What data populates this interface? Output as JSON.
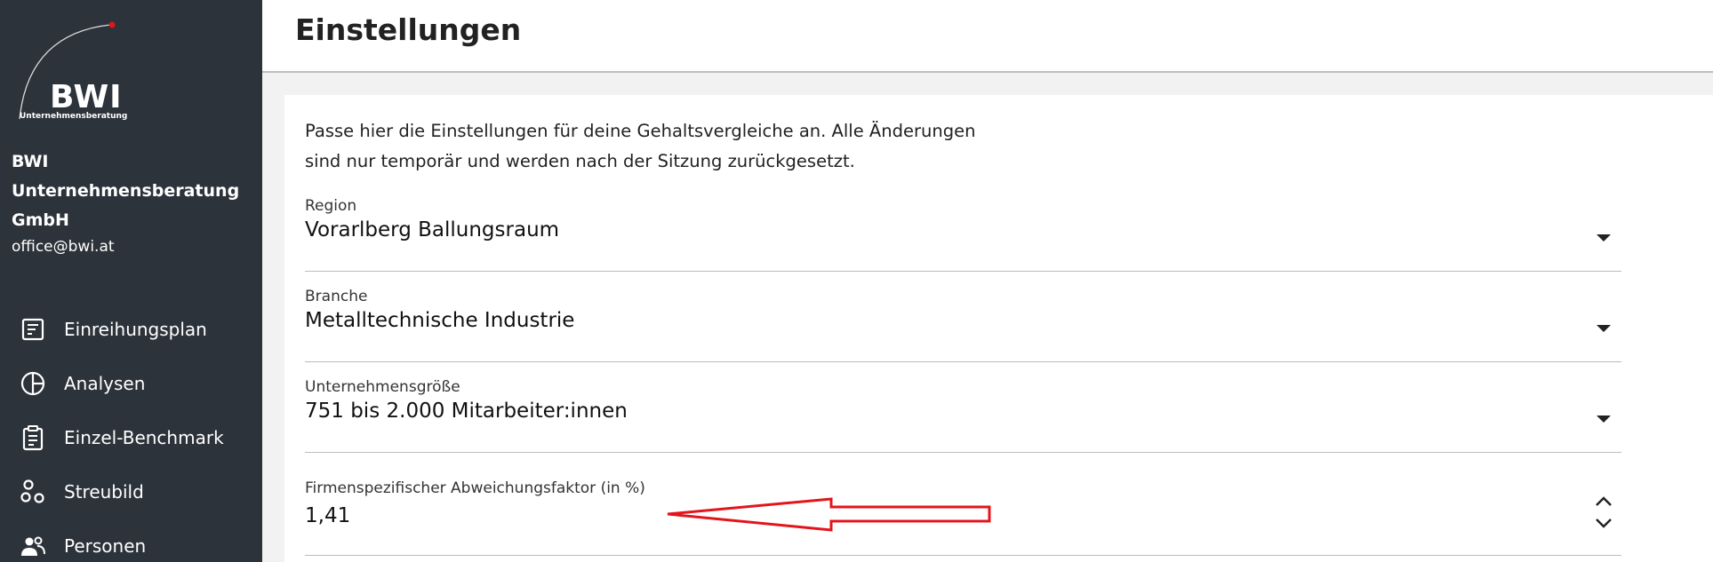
{
  "sidebar": {
    "logo_text": "BWI",
    "logo_subtext": "Unternehmensberatung",
    "company_name": "BWI Unternehmensberatung GmbH",
    "email": "office@bwi.at",
    "items": [
      {
        "label": "Einreihungsplan",
        "icon": "list-document-icon"
      },
      {
        "label": "Analysen",
        "icon": "pie-chart-icon"
      },
      {
        "label": "Einzel-Benchmark",
        "icon": "clipboard-icon"
      },
      {
        "label": "Streubild",
        "icon": "scatter-icon"
      },
      {
        "label": "Personen",
        "icon": "people-icon"
      }
    ]
  },
  "header": {
    "title": "Einstellungen"
  },
  "main": {
    "intro_line1": "Passe hier die Einstellungen für deine Gehaltsvergleiche an. Alle Änderungen",
    "intro_line2": "sind nur temporär und werden nach der Sitzung zurückgesetzt.",
    "fields": {
      "region": {
        "label": "Region",
        "value": "Vorarlberg Ballungsraum"
      },
      "branche": {
        "label": "Branche",
        "value": "Metalltechnische Industrie"
      },
      "size": {
        "label": "Unternehmensgröße",
        "value": "751 bis 2.000 Mitarbeiter:innen"
      },
      "factor": {
        "label": "Firmenspezifischer Abweichungsfaktor (in %)",
        "value": "1,41"
      }
    }
  },
  "annotation": {
    "arrow_color": "#e3151b"
  },
  "colors": {
    "sidebar_bg": "#2d333b",
    "accent_dot": "#e3151b"
  }
}
